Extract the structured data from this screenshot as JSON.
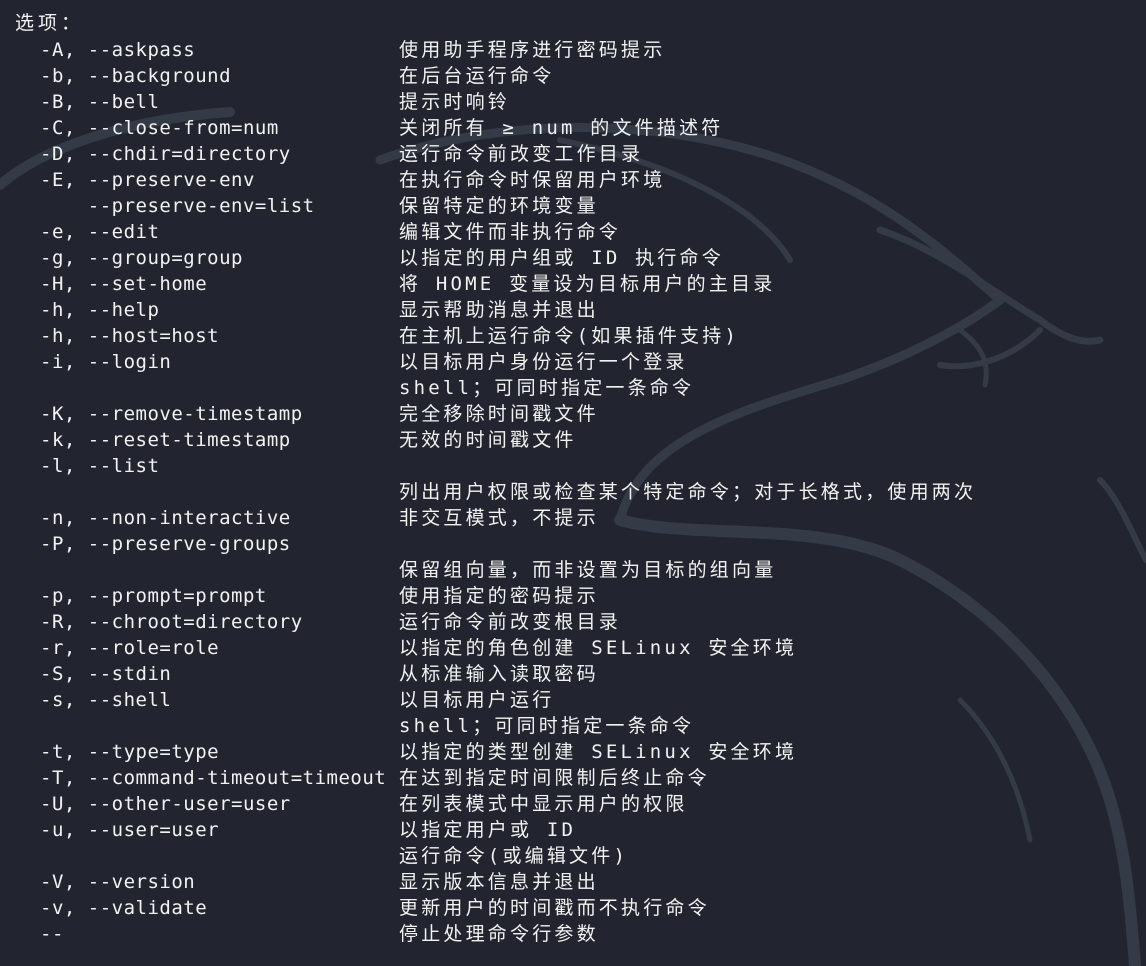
{
  "heading": "选项：",
  "rows": [
    {
      "option": "-A, --askpass",
      "description": "使用助手程序进行密码提示"
    },
    {
      "option": "-b, --background",
      "description": "在后台运行命令"
    },
    {
      "option": "-B, --bell",
      "description": "提示时响铃"
    },
    {
      "option": "-C, --close-from=num",
      "description": "关闭所有 ≥ num 的文件描述符"
    },
    {
      "option": "-D, --chdir=directory",
      "description": "运行命令前改变工作目录"
    },
    {
      "option": "-E, --preserve-env",
      "description": "在执行命令时保留用户环境"
    },
    {
      "option": "    --preserve-env=list",
      "description": "保留特定的环境变量"
    },
    {
      "option": "-e, --edit",
      "description": "编辑文件而非执行命令"
    },
    {
      "option": "-g, --group=group",
      "description": "以指定的用户组或 ID 执行命令"
    },
    {
      "option": "-H, --set-home",
      "description": "将 HOME 变量设为目标用户的主目录"
    },
    {
      "option": "-h, --help",
      "description": "显示帮助消息并退出"
    },
    {
      "option": "-h, --host=host",
      "description": "在主机上运行命令(如果插件支持)"
    },
    {
      "option": "-i, --login",
      "description": "以目标用户身份运行一个登录"
    },
    {
      "option": "",
      "description": "shell；可同时指定一条命令"
    },
    {
      "option": "-K, --remove-timestamp",
      "description": "完全移除时间戳文件"
    },
    {
      "option": "-k, --reset-timestamp",
      "description": "无效的时间戳文件"
    },
    {
      "option": "-l, --list",
      "description": ""
    },
    {
      "option": "",
      "description": "列出用户权限或检查某个特定命令；对于长格式，使用两次"
    },
    {
      "option": "-n, --non-interactive",
      "description": "非交互模式，不提示"
    },
    {
      "option": "-P, --preserve-groups",
      "description": ""
    },
    {
      "option": "",
      "description": "保留组向量，而非设置为目标的组向量"
    },
    {
      "option": "-p, --prompt=prompt",
      "description": "使用指定的密码提示"
    },
    {
      "option": "-R, --chroot=directory",
      "description": "运行命令前改变根目录"
    },
    {
      "option": "-r, --role=role",
      "description": "以指定的角色创建 SELinux 安全环境"
    },
    {
      "option": "-S, --stdin",
      "description": "从标准输入读取密码"
    },
    {
      "option": "-s, --shell",
      "description": "以目标用户运行"
    },
    {
      "option": "",
      "description": "shell；可同时指定一条命令"
    },
    {
      "option": "-t, --type=type",
      "description": "以指定的类型创建 SELinux 安全环境"
    },
    {
      "option": "-T, --command-timeout=timeout",
      "description": "在达到指定时间限制后终止命令"
    },
    {
      "option": "-U, --other-user=user",
      "description": "在列表模式中显示用户的权限"
    },
    {
      "option": "-u, --user=user",
      "description": "以指定用户或 ID"
    },
    {
      "option": "",
      "description": "运行命令(或编辑文件)"
    },
    {
      "option": "-V, --version",
      "description": "显示版本信息并退出"
    },
    {
      "option": "-v, --validate",
      "description": "更新用户的时间戳而不执行命令"
    },
    {
      "option": "--",
      "description": "停止处理命令行参数"
    }
  ],
  "background_icon": "kali-dragon-watermark-icon",
  "colors": {
    "background": "#22252f",
    "text": "#f2f2f2",
    "watermark": "#3a3f4d"
  }
}
